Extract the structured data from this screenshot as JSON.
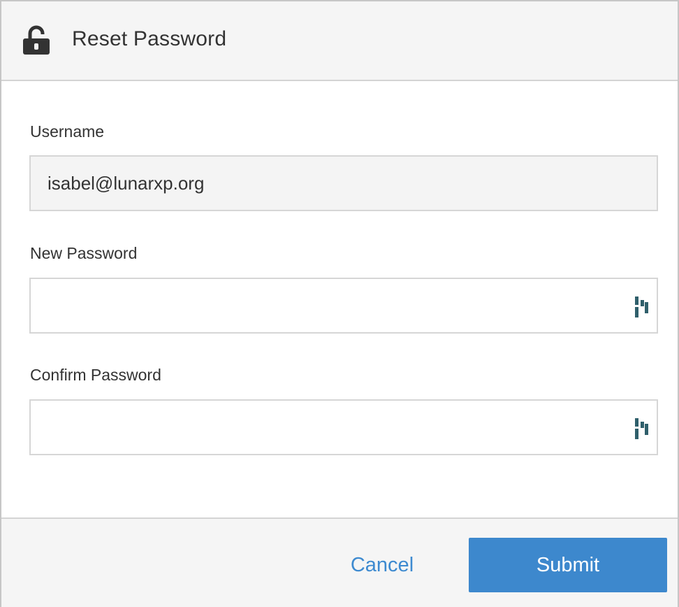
{
  "dialog": {
    "title": "Reset Password",
    "header_icon": "unlocked-padlock-icon"
  },
  "form": {
    "username": {
      "label": "Username",
      "value": "isabel@lunarxp.org"
    },
    "new_password": {
      "label": "New Password",
      "value": "",
      "field_icon": "password-manager-icon"
    },
    "confirm_password": {
      "label": "Confirm Password",
      "value": "",
      "field_icon": "password-manager-icon"
    }
  },
  "footer": {
    "cancel_label": "Cancel",
    "submit_label": "Submit"
  },
  "colors": {
    "accent": "#3d88cd",
    "link": "#3d8ad0",
    "icon": "#2f5f6b",
    "header_bg": "#f5f5f5"
  }
}
